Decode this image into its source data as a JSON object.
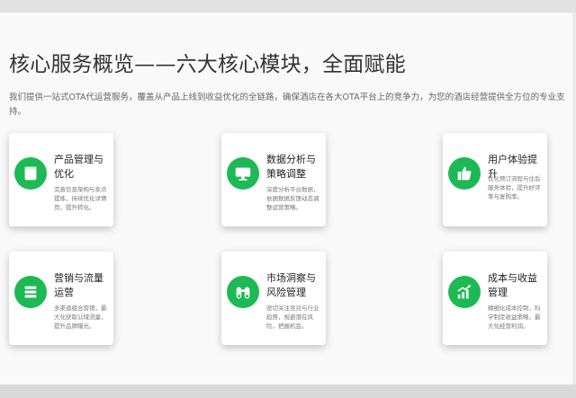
{
  "page": {
    "title": "核心服务概览——六大核心模块，全面赋能",
    "intro": "我们提供一站式OTA代运营服务，覆盖从产品上线到收益优化的全链路，确保酒店在各大OTA平台上的竞争力，为您的酒店经营提供全方位的专业支持。"
  },
  "modules": [
    {
      "title": "产品管理与优化",
      "desc": "完善信息架构与卖点提炼，持续优化详情页，提升转化。",
      "icon": "square-icon"
    },
    {
      "title": "数据分析与策略调整",
      "desc": "深度分析平台数据，依据数据反馈动态调整运营策略。",
      "icon": "monitor-icon"
    },
    {
      "title": "用户体验提升",
      "desc": "优化预订流程与住后服务体验，提升好评率与复购率。",
      "icon": "thumbs-up-icon"
    },
    {
      "title": "营销与流量运营",
      "desc": "多渠道组合营销，最大化获取公域流量，提升品牌曝光。",
      "icon": "list-icon"
    },
    {
      "title": "市场洞察与风险管理",
      "desc": "密切关注竞对与行业趋势，规避潜在风险，把握机会。",
      "icon": "binoculars-icon"
    },
    {
      "title": "成本与收益管理",
      "desc": "精细化成本控制，科学制定收益策略，最大化经营利润。",
      "icon": "chart-up-icon"
    }
  ]
}
